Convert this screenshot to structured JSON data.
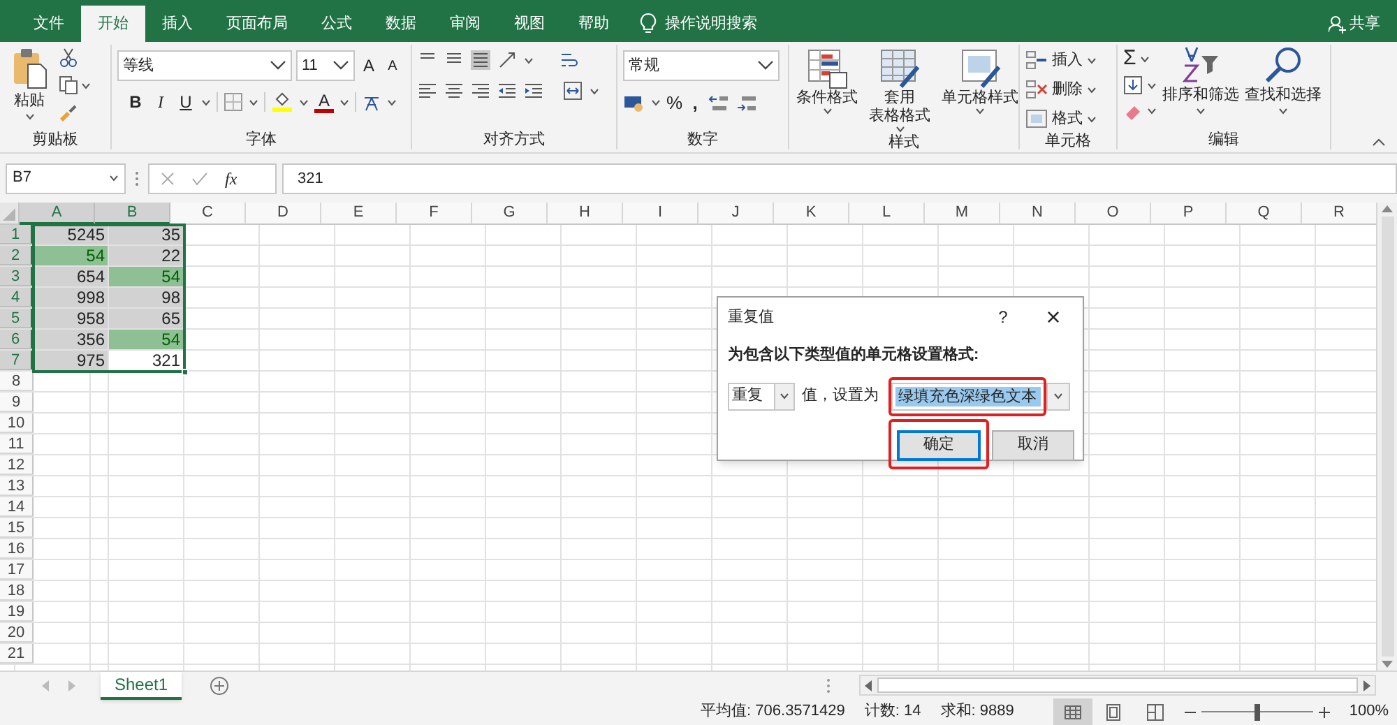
{
  "tabs": [
    {
      "label": "文件",
      "selected": false
    },
    {
      "label": "开始",
      "selected": true
    },
    {
      "label": "插入",
      "selected": false
    },
    {
      "label": "页面布局",
      "selected": false
    },
    {
      "label": "公式",
      "selected": false
    },
    {
      "label": "数据",
      "selected": false
    },
    {
      "label": "审阅",
      "selected": false
    },
    {
      "label": "视图",
      "selected": false
    },
    {
      "label": "帮助",
      "selected": false
    }
  ],
  "search": {
    "placeholder": "操作说明搜索"
  },
  "share": "共享",
  "ribbon": {
    "clipboard": {
      "paste": "粘贴",
      "label": "剪贴板"
    },
    "font": {
      "name": "等线",
      "size": "11",
      "grow": "A",
      "shrink": "A",
      "bold": "B",
      "italic": "I",
      "underline": "U",
      "font_color": "A",
      "label": "字体"
    },
    "alignment": {
      "label": "对齐方式"
    },
    "number": {
      "format": "常规",
      "percent": "%",
      "comma": ",",
      "label": "数字"
    },
    "styles": {
      "buttons": [
        [
          "条件格式"
        ],
        [
          "套用",
          "表格格式"
        ],
        [
          "单元格样式"
        ]
      ],
      "label": "样式"
    },
    "cells": {
      "items": [
        "插入",
        "删除",
        "格式"
      ],
      "label": "单元格"
    },
    "editing": {
      "sum": "Σ",
      "buttons": [
        "排序和筛选",
        "查找和选择"
      ],
      "label": "编辑"
    }
  },
  "formula_bar": {
    "name_box": "B7",
    "fx": "fx",
    "value": "321"
  },
  "columns": [
    {
      "label": "A",
      "selected": true
    },
    {
      "label": "B",
      "selected": true
    },
    {
      "label": "C",
      "selected": false
    },
    {
      "label": "D",
      "selected": false
    },
    {
      "label": "E",
      "selected": false
    },
    {
      "label": "F",
      "selected": false
    },
    {
      "label": "G",
      "selected": false
    },
    {
      "label": "H",
      "selected": false
    },
    {
      "label": "I",
      "selected": false
    },
    {
      "label": "J",
      "selected": false
    },
    {
      "label": "K",
      "selected": false
    },
    {
      "label": "L",
      "selected": false
    },
    {
      "label": "M",
      "selected": false
    },
    {
      "label": "N",
      "selected": false
    },
    {
      "label": "O",
      "selected": false
    },
    {
      "label": "P",
      "selected": false
    },
    {
      "label": "Q",
      "selected": false
    },
    {
      "label": "R",
      "selected": false
    }
  ],
  "rows": [
    {
      "header": "1",
      "selected": true,
      "cells": [
        {
          "value": "5245",
          "selected": true,
          "duplicate": false
        },
        {
          "value": "35",
          "selected": true,
          "duplicate": false
        }
      ]
    },
    {
      "header": "2",
      "selected": true,
      "cells": [
        {
          "value": "54",
          "selected": true,
          "duplicate": true
        },
        {
          "value": "22",
          "selected": true,
          "duplicate": false
        }
      ]
    },
    {
      "header": "3",
      "selected": true,
      "cells": [
        {
          "value": "654",
          "selected": true,
          "duplicate": false
        },
        {
          "value": "54",
          "selected": true,
          "duplicate": true
        }
      ]
    },
    {
      "header": "4",
      "selected": true,
      "cells": [
        {
          "value": "998",
          "selected": true,
          "duplicate": false
        },
        {
          "value": "98",
          "selected": true,
          "duplicate": false
        }
      ]
    },
    {
      "header": "5",
      "selected": true,
      "cells": [
        {
          "value": "958",
          "selected": true,
          "duplicate": false
        },
        {
          "value": "65",
          "selected": true,
          "duplicate": false
        }
      ]
    },
    {
      "header": "6",
      "selected": true,
      "cells": [
        {
          "value": "356",
          "selected": true,
          "duplicate": false
        },
        {
          "value": "54",
          "selected": true,
          "duplicate": true
        }
      ]
    },
    {
      "header": "7",
      "selected": true,
      "cells": [
        {
          "value": "975",
          "selected": true,
          "duplicate": false
        },
        {
          "value": "321",
          "selected": false,
          "duplicate": false
        }
      ]
    },
    {
      "header": "8",
      "selected": false
    },
    {
      "header": "9",
      "selected": false
    },
    {
      "header": "10",
      "selected": false
    },
    {
      "header": "11",
      "selected": false
    },
    {
      "header": "12",
      "selected": false
    },
    {
      "header": "13",
      "selected": false
    },
    {
      "header": "14",
      "selected": false
    },
    {
      "header": "15",
      "selected": false
    },
    {
      "header": "16",
      "selected": false
    },
    {
      "header": "17",
      "selected": false
    },
    {
      "header": "18",
      "selected": false
    },
    {
      "header": "19",
      "selected": false
    },
    {
      "header": "20",
      "selected": false
    },
    {
      "header": "21",
      "selected": false
    }
  ],
  "sheets": [
    {
      "label": "Sheet1",
      "selected": true
    }
  ],
  "status_bar": {
    "average": "平均值: 706.3571429",
    "count": "计数: 14",
    "sum": "求和: 9889",
    "zoom": "100%",
    "zoom_slider": {
      "level": 0.5
    }
  },
  "dialog": {
    "title": "重复值",
    "help": "?",
    "close": "×",
    "instruction": "为包含以下类型值的单元格设置格式:",
    "type": "重复",
    "between": "值，设置为",
    "format": "绿填充色深绿色文本",
    "ok": "确定",
    "cancel": "取消"
  }
}
